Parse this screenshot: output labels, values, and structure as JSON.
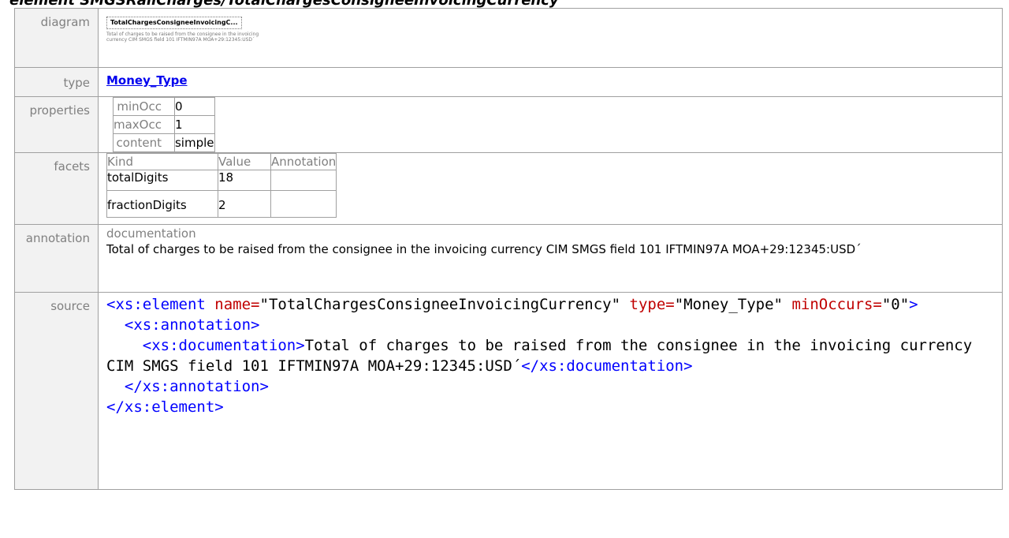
{
  "heading": "element SMGSRailCharges/TotalChargesConsigneeInvoicingCurrency",
  "rows": {
    "diagram": {
      "label": "diagram",
      "box_name": "TotalChargesConsigneeInvoicingC...",
      "box_doc": "Total of charges to be raised from the consignee in the invoicing currency CIM SMGS field 101 IFTMIN97A MOA+29:12345:USD´"
    },
    "type": {
      "label": "type",
      "value": "Money_Type"
    },
    "properties": {
      "label": "properties",
      "items": [
        {
          "key": "minOcc",
          "value": "0"
        },
        {
          "key": "maxOcc",
          "value": "1"
        },
        {
          "key": "content",
          "value": "simple"
        }
      ]
    },
    "facets": {
      "label": "facets",
      "headers": [
        "Kind",
        "Value",
        "Annotation"
      ],
      "items": [
        {
          "kind": "totalDigits",
          "value": "18"
        },
        {
          "kind": "fractionDigits",
          "value": "2"
        }
      ]
    },
    "annotation": {
      "label": "annotation",
      "heading": "documentation",
      "text": "Total of charges to be raised from the consignee in the invoicing currency CIM SMGS field 101 IFTMIN97A MOA+29:12345:USD´"
    },
    "source": {
      "label": "source",
      "element_open": "<xs:element",
      "name_attr": "name=",
      "name_val": "\"TotalChargesConsigneeInvoicingCurrency\"",
      "type_attr": "type=",
      "type_val": "\"Money_Type\"",
      "minoccurs_attr": "minOccurs=",
      "minoccurs_val": "\"0\"",
      "gt": ">",
      "annotation_open": "<xs:annotation>",
      "doc_open": "<xs:documentation>",
      "doc_text": "Total of charges to be raised from the consignee in the invoicing currency CIM SMGS field 101 IFTMIN97A MOA+29:12345:USD´",
      "doc_close": "</xs:documentation>",
      "annotation_close": "</xs:annotation>",
      "element_close": "</xs:element>"
    }
  }
}
